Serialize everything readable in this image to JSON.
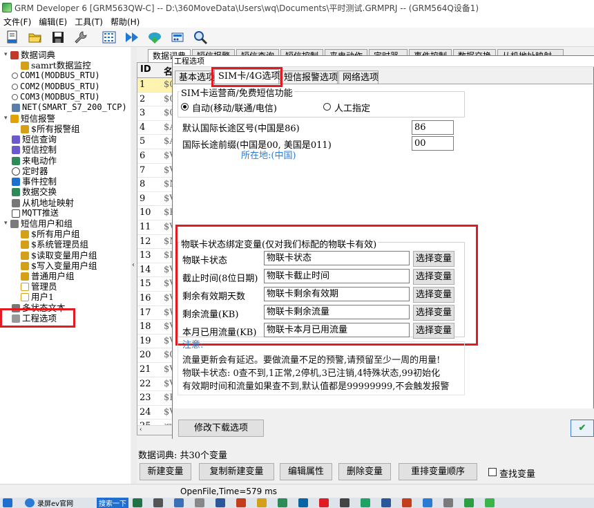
{
  "window": {
    "title": "GRM Developer 6 [GRM563QW-C]  -- D:\\360MoveData\\Users\\wq\\Documents\\平时测试.GRMPRJ -- (GRM564Q设备1)"
  },
  "menu": [
    "文件(F)",
    "编辑(E)",
    "工具(T)",
    "帮助(H)"
  ],
  "toolbar_icons": [
    "new-file-icon",
    "open-folder-icon",
    "save-icon",
    "wrench-icon",
    "grid-icon",
    "fast-forward-icon",
    "download-icon",
    "device-icon",
    "search-icon"
  ],
  "tree": {
    "items": [
      {
        "label": "数据词典",
        "icon": "book-icon",
        "color": "#c0392b",
        "expand": "▾"
      },
      {
        "label": "samrt数据监控",
        "icon": "tag-icon",
        "color": "#d4a017"
      },
      {
        "label": "COM1(MODBUS_RTU)",
        "icon": "plug-icon",
        "color": "#555555"
      },
      {
        "label": "COM2(MODBUS_RTU)",
        "icon": "plug-icon",
        "color": "#555555"
      },
      {
        "label": "COM3(MODBUS_RTU)",
        "icon": "plug-icon",
        "color": "#555555"
      },
      {
        "label": "NET(SMART_S7_200_TCP)",
        "icon": "network-icon",
        "color": "#555555"
      },
      {
        "label": "短信报警",
        "icon": "bell-icon",
        "color": "#e2a100",
        "expand": "▾"
      },
      {
        "label": "$所有报警组",
        "icon": "tag-icon",
        "color": "#d4a017"
      },
      {
        "label": "短信查询",
        "icon": "query-icon",
        "color": "#6a5acd"
      },
      {
        "label": "短信控制",
        "icon": "control-icon",
        "color": "#6a5acd"
      },
      {
        "label": "来电动作",
        "icon": "phone-icon",
        "color": "#2e8b57"
      },
      {
        "label": "定时器",
        "icon": "clock-icon",
        "color": "#444444"
      },
      {
        "label": "事件控制",
        "icon": "event-icon",
        "color": "#1e6fd0"
      },
      {
        "label": "数据交换",
        "icon": "exchange-icon",
        "color": "#2e8b57"
      },
      {
        "label": "从机地址映射",
        "icon": "map-icon",
        "color": "#444444"
      },
      {
        "label": "MQTT推送",
        "icon": "mqtt-icon",
        "color": "#444444"
      },
      {
        "label": "短信用户和组",
        "icon": "users-icon",
        "color": "#7a7a7a",
        "expand": "▾"
      },
      {
        "label": "$所有用户组",
        "icon": "tag-icon",
        "color": "#d4a017"
      },
      {
        "label": "$系统管理员组",
        "icon": "tag-icon",
        "color": "#d4a017"
      },
      {
        "label": "$读取变量用户组",
        "icon": "tag-icon",
        "color": "#d4a017"
      },
      {
        "label": "$写入变量用户组",
        "icon": "tag-icon",
        "color": "#d4a017"
      },
      {
        "label": "普通用户组",
        "icon": "tag-icon",
        "color": "#d4a017"
      },
      {
        "label": "管理员",
        "icon": "user-icon",
        "color": "#d4a017"
      },
      {
        "label": "用户1",
        "icon": "user-icon",
        "color": "#d4a017"
      },
      {
        "label": "多状态文本",
        "icon": "text-icon",
        "color": "#444444"
      },
      {
        "label": "工程选项",
        "icon": "wrench-icon",
        "color": "#777777"
      }
    ]
  },
  "main_tabs": [
    "数据词典",
    "短信报警",
    "短信查询",
    "短信控制",
    "来电动作",
    "定时器",
    "事件控制",
    "数据交换",
    "从机地址映射"
  ],
  "grid": {
    "headers": [
      "ID",
      "名"
    ],
    "rows": [
      {
        "id": "1",
        "v": "$0"
      },
      {
        "id": "2",
        "v": "$0"
      },
      {
        "id": "3",
        "v": "$0"
      },
      {
        "id": "4",
        "v": "$A"
      },
      {
        "id": "5",
        "v": "$A"
      },
      {
        "id": "6",
        "v": "$V"
      },
      {
        "id": "7",
        "v": "$V"
      },
      {
        "id": "8",
        "v": "$N"
      },
      {
        "id": "9",
        "v": "$V"
      },
      {
        "id": "10",
        "v": "$H"
      },
      {
        "id": "11",
        "v": "$V"
      },
      {
        "id": "12",
        "v": "$M"
      },
      {
        "id": "13",
        "v": "$I"
      },
      {
        "id": "14",
        "v": "$V"
      },
      {
        "id": "15",
        "v": "$V"
      },
      {
        "id": "16",
        "v": "$V"
      },
      {
        "id": "17",
        "v": "$W"
      },
      {
        "id": "18",
        "v": "$V"
      },
      {
        "id": "19",
        "v": "$V"
      },
      {
        "id": "20",
        "v": "$0"
      },
      {
        "id": "21",
        "v": "$V"
      },
      {
        "id": "22",
        "v": "$V"
      },
      {
        "id": "23",
        "v": "$H"
      },
      {
        "id": "24",
        "v": "$V"
      },
      {
        "id": "25",
        "v": "温"
      }
    ]
  },
  "dialog": {
    "title": "工程选项",
    "tabs": [
      "基本选项",
      "SIM卡/4G选项",
      "短信报警选项",
      "网络选项"
    ],
    "sim_group": {
      "legend": "SIM卡运营商/免费短信功能",
      "radio_auto": "自动(移动/联通/电信)",
      "radio_manual": "人工指定"
    },
    "country_code_label": "默认国际长途区号(中国是86)",
    "country_code_value": "86",
    "prefix_label": "国际长途前缀(中国是00, 美国是011)",
    "prefix_value": "00",
    "location": "所在地:(中国)",
    "iot_group": {
      "legend": "物联卡状态绑定变量(仅对我们标配的物联卡有效)",
      "rows": [
        {
          "label": "物联卡状态",
          "value": "物联卡状态",
          "button": "选择变量"
        },
        {
          "label": "截止时间(8位日期)",
          "value": "物联卡截止时间",
          "button": "选择变量"
        },
        {
          "label": "剩余有效期天数",
          "value": "物联卡剩余有效期",
          "button": "选择变量"
        },
        {
          "label": "剩余流量(KB)",
          "value": "物联卡剩余流量",
          "button": "选择变量"
        },
        {
          "label": "本月已用流量(KB)",
          "value": "物联卡本月已用流量",
          "button": "选择变量"
        }
      ]
    },
    "note_title": "注意:",
    "notes": [
      "流量更新会有延迟。要做流量不足的预警,请预留至少一周的用量!",
      "物联卡状态: 0查不到,1正常,2停机,3已注销,4特殊状态,99初始化",
      "有效期时间和流量如果查不到,默认值都是99999999,不会触发报警"
    ],
    "modify_button": "修改下载选项",
    "ok_button": "✔"
  },
  "summary": "数据词典: 共30个变量",
  "bottom_buttons": [
    "新建变量",
    "复制新建变量",
    "编辑属性",
    "删除变量",
    "重排变量顺序"
  ],
  "find_checkbox": "查找变量",
  "status": "OpenFile,Time=579 ms",
  "taskbar": {
    "items": [
      "录屏ev官网",
      "搜索一下"
    ]
  },
  "colors": {
    "highlight": "#e21b22",
    "accent_blue": "#2a7bd4",
    "selected_row": "#fff3b0"
  }
}
